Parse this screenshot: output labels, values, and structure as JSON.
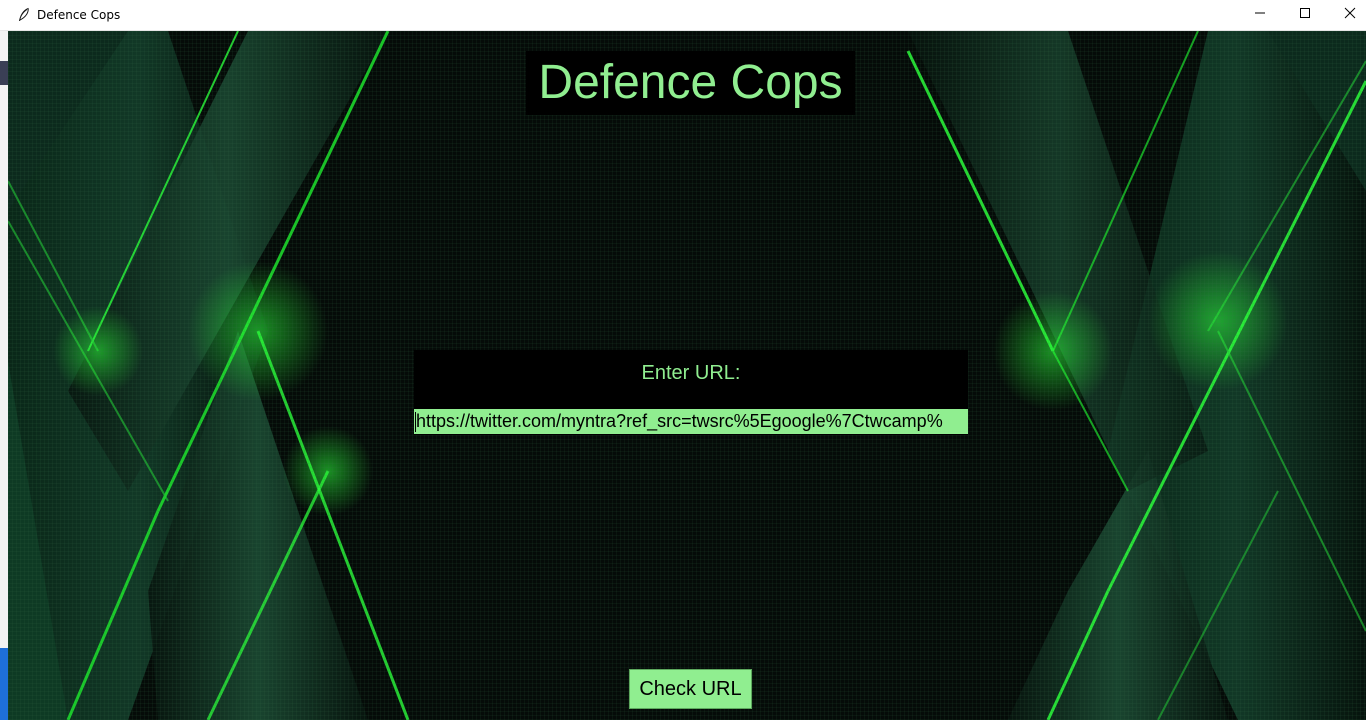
{
  "window": {
    "title": "Defence Cops",
    "app_icon": "feather-icon",
    "controls": [
      "minimize-icon",
      "maximize-icon",
      "close-icon"
    ]
  },
  "main": {
    "heading": "Defence Cops",
    "url_label": "Enter URL:",
    "url_value": "https://twitter.com/myntra?ref_src=twsrc%5Egoogle%7Ctwcamp%",
    "check_button_label": "Check URL"
  },
  "colors": {
    "accent_text": "#90ee90",
    "panel_background": "#000000",
    "background_glow": "#2bff3a"
  }
}
